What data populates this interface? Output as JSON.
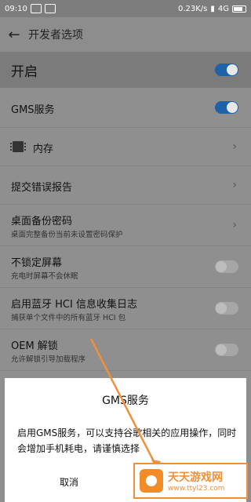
{
  "status_bar": {
    "time": "09:10",
    "speed": "0.23K/s",
    "network": "4G"
  },
  "header": {
    "title": "开发者选项"
  },
  "master_switch": {
    "label": "开启",
    "state": "on"
  },
  "settings": [
    {
      "title": "GMS服务",
      "subtitle": "",
      "control": "toggle-on"
    },
    {
      "title": "内存",
      "subtitle": "",
      "control": "chevron"
    },
    {
      "title": "提交错误报告",
      "subtitle": "",
      "control": "chevron"
    },
    {
      "title": "桌面备份密码",
      "subtitle": "桌面完整备份当前未设置密码保护",
      "control": "chevron"
    },
    {
      "title": "不锁定屏幕",
      "subtitle": "充电时屏幕不会休眠",
      "control": "toggle-off"
    },
    {
      "title": "启用蓝牙 HCI 信息收集日志",
      "subtitle": "捕获单个文件中的所有蓝牙 HCI 包",
      "control": "toggle-off"
    },
    {
      "title": "OEM 解锁",
      "subtitle": "允许解锁引导加载程序",
      "control": "toggle-off"
    }
  ],
  "dialog": {
    "title": "GMS服务",
    "message": "启用GMS服务，可以支持谷歌相关的应用操作，同时会增加手机耗电，请谨慎选择",
    "cancel_label": "取消"
  },
  "watermark": {
    "name": "天天游戏网",
    "url": "www.ttyl23.com"
  },
  "colors": {
    "toggle_on": "#1e63a8",
    "dim_overlay": "#8f8f8f",
    "arrow": "#f0903a"
  }
}
